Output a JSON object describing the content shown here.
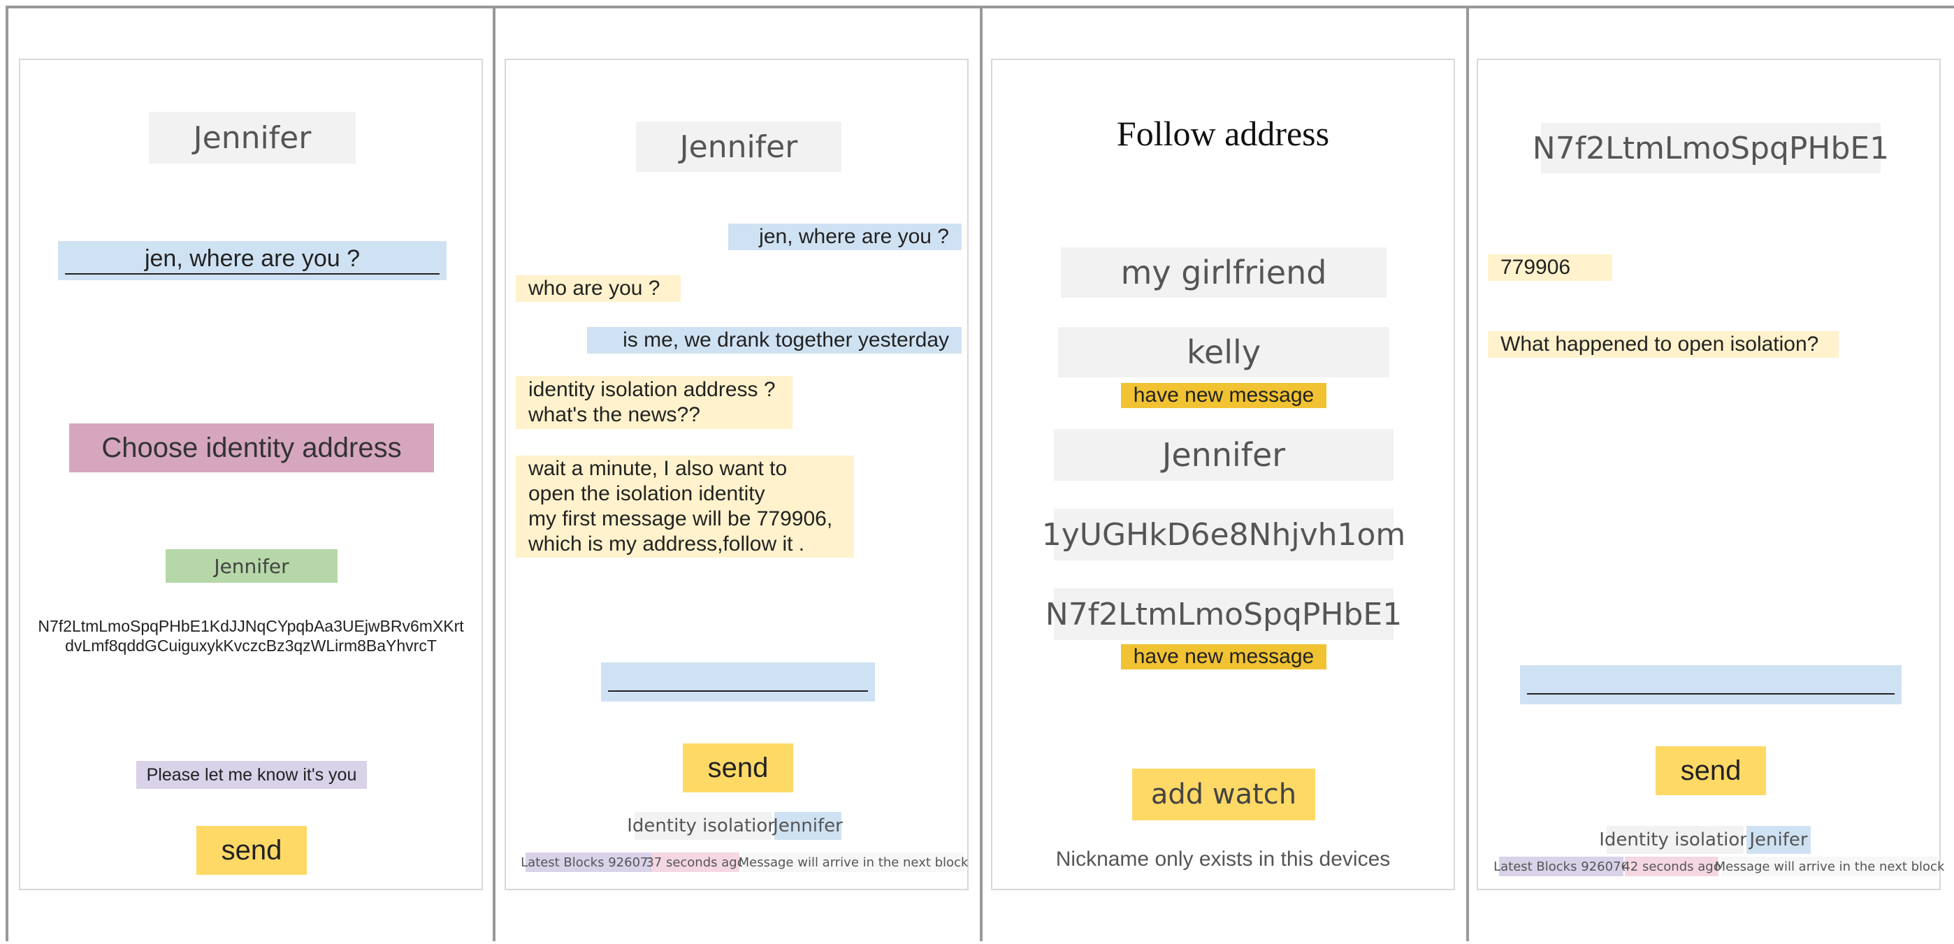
{
  "screen1": {
    "name_title": "Jennifer",
    "message_input": "jen, where are you ?",
    "choose_button": "Choose identity address",
    "identity_chip": "Jennifer",
    "address_text": "N7f2LtmLmoSpqPHbE1KdJJNqCYpqbAa3UEjwBRv6mXKrt\ndvLmf8qddGCuiguxykKvczcBz3qzWLirm8BaYhvrcT",
    "prompt_text": "Please let me know it's you",
    "send_label": "send"
  },
  "screen2": {
    "name_title": "Jennifer",
    "messages": [
      {
        "text": "jen, where are you ?",
        "side": "right"
      },
      {
        "text": "who are you ?",
        "side": "left"
      },
      {
        "text": "is me, we drank together yesterday",
        "side": "right"
      },
      {
        "text": "identity isolation address ?\nwhat's the news??",
        "side": "left"
      },
      {
        "text": "wait a minute, I also want to\nopen the isolation identity\nmy first message will be 779906,\nwhich is my address,follow it .",
        "side": "left"
      }
    ],
    "send_label": "send",
    "mode_label": "Identity isolation",
    "mode_name": "Jennifer",
    "latest_blocks": "Latest Blocks 926073",
    "time_ago": "37 seconds ago",
    "arrival_note": "Message will arrive in the next block"
  },
  "screen3": {
    "title": "Follow address",
    "items": [
      {
        "label": "my girlfriend",
        "badge": ""
      },
      {
        "label": "kelly",
        "badge": "have new message"
      },
      {
        "label": "Jennifer",
        "badge": ""
      },
      {
        "label": "1yUGHkD6e8Nhjvh1om",
        "badge": ""
      },
      {
        "label": "N7f2LtmLmoSpqPHbE1",
        "badge": "have new message"
      }
    ],
    "add_watch_label": "add watch",
    "footer_note": "Nickname only exists in this devices"
  },
  "screen4": {
    "address_title": "N7f2LtmLmoSpqPHbE1",
    "messages": [
      {
        "text": "779906",
        "side": "left"
      },
      {
        "text": "What happened to open isolation?",
        "side": "left"
      }
    ],
    "send_label": "send",
    "mode_label": "Identity isolation",
    "mode_name": "Jenifer",
    "latest_blocks": "Latest Blocks 926076",
    "time_ago": "42 seconds ago",
    "arrival_note": "Message will arrive in the next block"
  },
  "colors": {
    "outgoing_bubble": "#cfe2f3",
    "incoming_bubble": "#fff2cc",
    "send_button": "#ffd966",
    "new_message_badge": "#f1c232",
    "choose_button": "#d5a6bd",
    "identity_chip": "#b6d7a8",
    "prompt_chip": "#d9d2e9"
  }
}
